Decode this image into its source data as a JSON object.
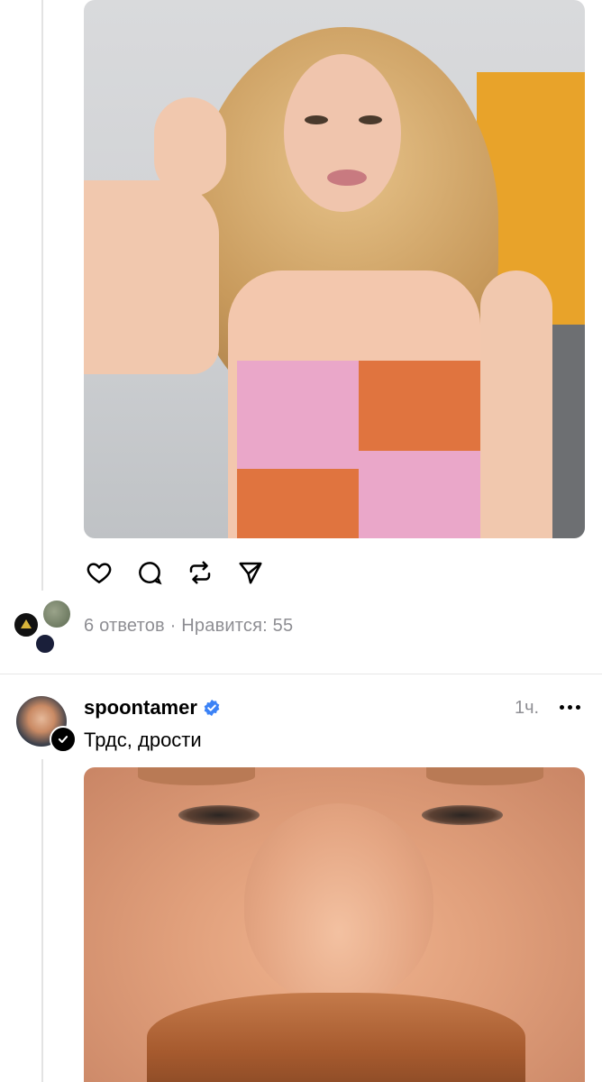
{
  "post1": {
    "image": {
      "alt": ""
    },
    "actions": {
      "like_icon": "heart-icon",
      "reply_icon": "comment-icon",
      "repost_icon": "repost-icon",
      "share_icon": "send-icon"
    },
    "replies_text": "6 ответов",
    "separator": "·",
    "likes_text": "Нравится: 55"
  },
  "post2": {
    "username": "spoontamer",
    "verified_icon": "verified-badge-icon",
    "time": "1ч.",
    "more_icon": "more-horizontal-icon",
    "text": "Трдс, дрости"
  },
  "colors": {
    "verified": "#3b82f6",
    "meta": "#8e8e93",
    "divider": "#e6e6e6"
  }
}
